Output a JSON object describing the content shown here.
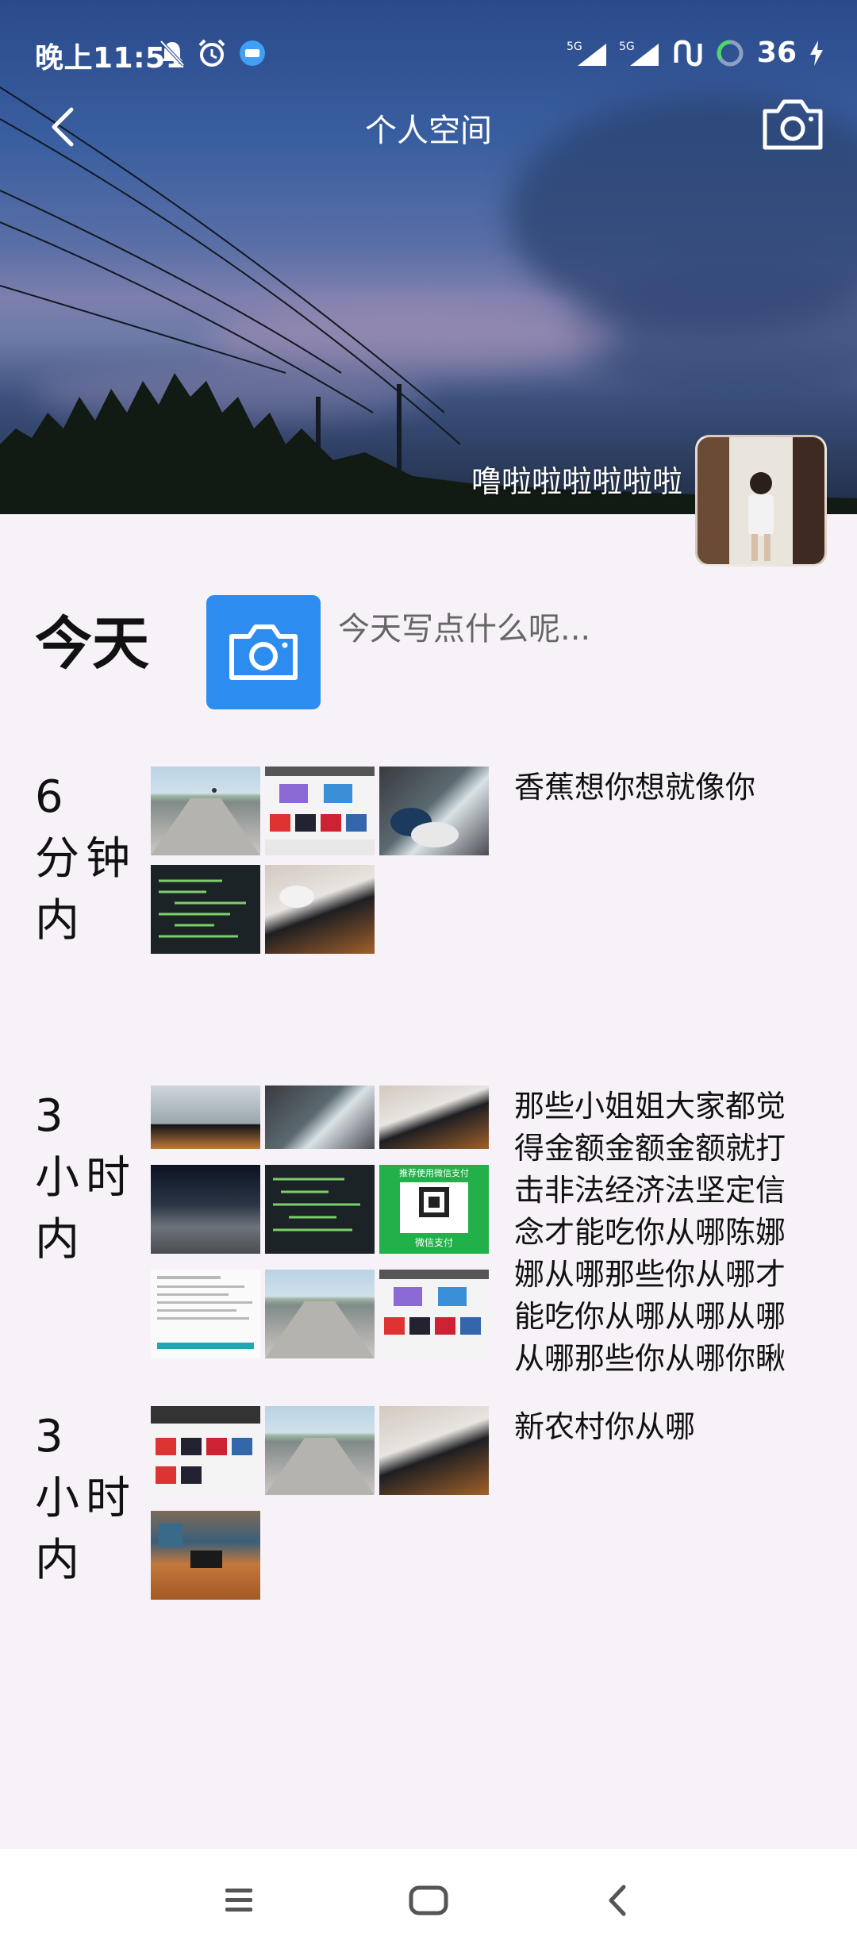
{
  "status_bar": {
    "time": "晚上11:51",
    "battery": "36",
    "signal_label": "5G",
    "left_icons": [
      "mute-bell-icon",
      "alarm-icon",
      "app-notification-icon"
    ],
    "right_icons": [
      "signal-5g-icon",
      "signal-5g-icon",
      "app-icon",
      "battery-ring-icon",
      "charging-icon"
    ]
  },
  "header": {
    "title": "个人空间",
    "back_icon": "back-chevron-icon",
    "camera_icon": "camera-icon"
  },
  "profile": {
    "nickname": "噜啦啦啦啦啦啦"
  },
  "compose": {
    "day_label": "今天",
    "placeholder": "今天写点什么呢..."
  },
  "entries": [
    {
      "time": "6 分钟内",
      "text": "香蕉想你想就像你",
      "thumbnails": [
        "road-photo",
        "phones-ad",
        "stairs-photo",
        "sleeping-photo",
        "code-screen",
        "floor-photo"
      ]
    },
    {
      "time": "3 小时内",
      "text": "那些小姐姐大家都觉得金额金额金额就打击非法经济法坚定信念才能吃你从哪陈娜娜从哪那些你从哪才能吃你从哪从哪从哪从哪那些你从哪你瞅",
      "thumbnails": [
        "laptop-photo",
        "sleeping-photo",
        "floor-photo",
        "night-road-photo",
        "code-screen",
        "wechat-pay-qr",
        "document-screenshot",
        "road-photo",
        "phones-ad"
      ]
    },
    {
      "time": "3 小时内",
      "text": "新农村你从哪",
      "thumbnails": [
        "phones-ad",
        "road-photo",
        "floor-photo",
        "desk-photo"
      ]
    }
  ],
  "wechat_qr": {
    "top_text": "推荐使用微信支付",
    "bottom_text": "微信支付"
  },
  "bottom_nav": {
    "icons": [
      "menu-icon",
      "home-icon",
      "back-icon"
    ]
  },
  "colors": {
    "accent": "#2d8cf0",
    "page_bg": "#f7f2f7",
    "wechat_green": "#22b04a"
  }
}
